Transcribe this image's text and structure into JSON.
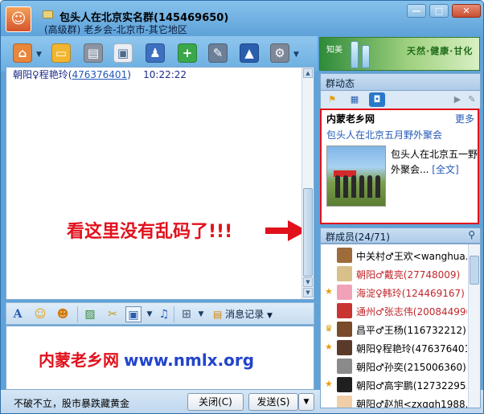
{
  "window": {
    "title": "包头人在北京实名群(145469650)",
    "subtitle": "(高级群) 老乡会-北京市-其它地区",
    "controls": [
      "—",
      "□",
      "✕"
    ]
  },
  "toolbar": {
    "icons": [
      "home-icon",
      "folder-icon",
      "notebook-icon",
      "card-icon",
      "apps-icon",
      "add-icon",
      "tools-icon",
      "graduation-icon",
      "settings-icon"
    ]
  },
  "banner": {
    "left_text": "知美",
    "slogan": "天然·健康·甘化"
  },
  "chat": {
    "message": {
      "sender": "朝阳♀程艳玲(",
      "qq": "476376401",
      "close_paren": ")",
      "time": "10:22:22"
    },
    "annotation": "看这里没有乱码了!!!"
  },
  "input_toolbar": {
    "message_record_label": "消息记录"
  },
  "input": {
    "ad_cn": "内蒙老乡网",
    "ad_url": "www.nmlx.org"
  },
  "footer": {
    "status": "不破不立，股市暴跌藏黄金",
    "close_label": "关闭(C)",
    "send_label": "发送(S)"
  },
  "group_feed": {
    "header": "群动态",
    "news_title": "内蒙老乡网",
    "more": "更多",
    "link": "包头人在北京五月野外聚会",
    "text": "包头人在北京五一野外聚会...",
    "full": "[全文]"
  },
  "members": {
    "header": "群成员(24/71)",
    "list": [
      {
        "name": "中关村♂王欢<wanghua...",
        "color": "#000000"
      },
      {
        "name": "朝阳♂戴亮(27748009)",
        "color": "#c0262b"
      },
      {
        "name": "海淀♀韩玲(124469167)",
        "color": "#c0262b"
      },
      {
        "name": "通州♂张志伟(200844996)",
        "color": "#c0262b"
      },
      {
        "name": "昌平♂王杨(116732212)",
        "color": "#000000"
      },
      {
        "name": "朝阳♀程艳玲(476376401)",
        "color": "#000000"
      },
      {
        "name": "朝阳♂孙奕(215006360)",
        "color": "#000000"
      },
      {
        "name": "朝阳♂高宇鹏(12732295...",
        "color": "#000000"
      },
      {
        "name": "朝阳♂赵旭<zxggh1988...",
        "color": "#000000"
      }
    ]
  }
}
